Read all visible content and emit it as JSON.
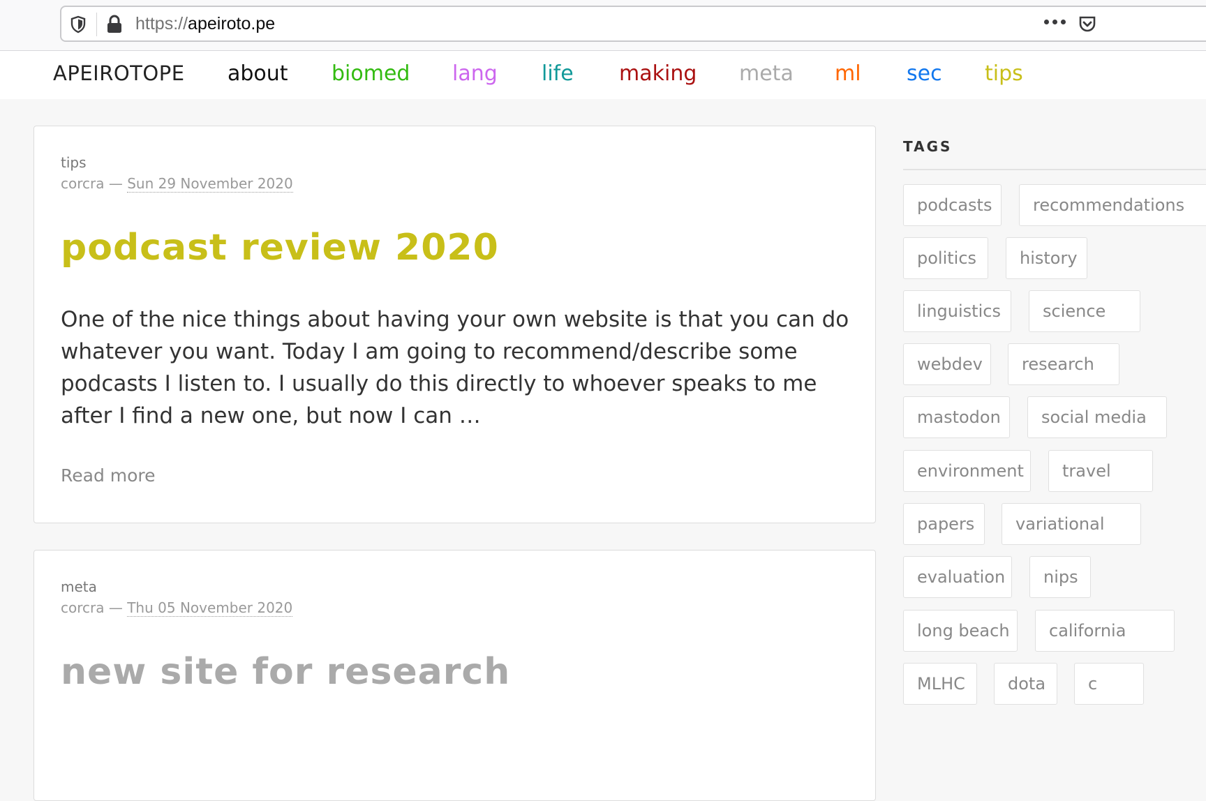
{
  "browser": {
    "url_scheme": "https://",
    "url_host": "apeiroto.pe"
  },
  "site": {
    "brand": "APEIROTOPE",
    "nav": [
      {
        "label": "about",
        "color": "#111111"
      },
      {
        "label": "biomed",
        "color": "#33bb11"
      },
      {
        "label": "lang",
        "color": "#cc66ee"
      },
      {
        "label": "life",
        "color": "#119999"
      },
      {
        "label": "making",
        "color": "#aa1111"
      },
      {
        "label": "meta",
        "color": "#aaaaaa"
      },
      {
        "label": "ml",
        "color": "#ff6600"
      },
      {
        "label": "sec",
        "color": "#1177ee"
      },
      {
        "label": "tips",
        "color": "#c8bf19"
      }
    ]
  },
  "posts": [
    {
      "category": "tips",
      "author": "corcra",
      "dash": "—",
      "date": "Sun 29 November 2020",
      "title": "podcast review 2020",
      "title_color": "#c8bf19",
      "excerpt": "One of the nice things about having your own website is that you can do whatever you want. Today I am going to recommend/describe some podcasts I listen to. I usually do this directly to whoever speaks to me after I find a new one, but now I can …",
      "read_more": "Read more"
    },
    {
      "category": "meta",
      "author": "corcra",
      "dash": "—",
      "date": "Thu 05 November 2020",
      "title": "new site for research",
      "title_color": "#aaaaaa"
    }
  ],
  "sidebar": {
    "heading": "TAGS",
    "tags": [
      "podcasts",
      "recommendations",
      "politics",
      "history",
      "linguistics",
      "science",
      "webdev",
      "research",
      "mastodon",
      "social media",
      "environment",
      "travel",
      "papers",
      "variational",
      "evaluation",
      "nips",
      "long beach",
      "california",
      "MLHC",
      "dota",
      "c"
    ]
  }
}
